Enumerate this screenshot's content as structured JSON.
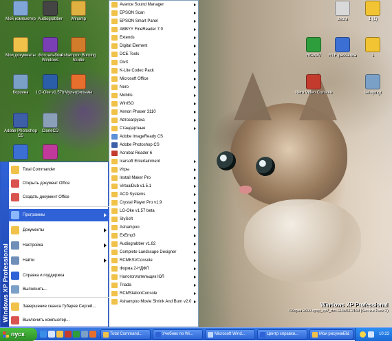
{
  "colors": {
    "taskbar": "#1f57c9",
    "start_green": "#2d8f27",
    "menu_highlight": "#2f62d7",
    "menu_border": "#7f9db9"
  },
  "desktop_icons": [
    {
      "label": "Мой компьютер",
      "icon": "my-computer-icon",
      "color": "#7fa6d6"
    },
    {
      "label": "Audiograbber",
      "icon": "audiograbber-icon",
      "color": "#444"
    },
    {
      "label": "Winamp",
      "icon": "winamp-icon",
      "color": "#e0b040"
    },
    {
      "label": "Мои документы",
      "icon": "folder-icon",
      "color": "#f1c24a"
    },
    {
      "label": "Фотоальбом Windows",
      "icon": "photo-album-icon",
      "color": "#7a3fb5"
    },
    {
      "label": "Ashampoo Burning Studio",
      "icon": "ashampoo-icon",
      "color": "#d07c2a"
    },
    {
      "label": "Корзина",
      "icon": "recycle-bin-icon",
      "color": "#7aa0c7"
    },
    {
      "label": "LG-Oke v1.57b",
      "icon": "lg-oke-icon",
      "color": "#2b5ea8"
    },
    {
      "label": "Мультфильмы",
      "icon": "cartoons-icon",
      "color": "#e76f2e"
    },
    {
      "label": "Adobe Photoshop CS",
      "icon": "photoshop-icon",
      "color": "#3d5fa8"
    },
    {
      "label": "CloneCD",
      "icon": "clonecd-icon",
      "color": "#8aa0b8"
    },
    {
      "label": "",
      "icon": "app-icon",
      "color": "#3b6fd4"
    },
    {
      "label": "",
      "icon": "app2-icon",
      "color": "#c2399c"
    },
    {
      "label": "zebra",
      "icon": "zebra-icon",
      "color": "#d9d9d9"
    },
    {
      "label": "1 (1)",
      "icon": "doc-icon",
      "color": "#f2c332"
    },
    {
      "label": "RCM3V",
      "icon": "rcm-icon",
      "color": "#2e9d3b"
    },
    {
      "label": "RTF-рассылка",
      "icon": "rtf-icon",
      "color": "#3b6fd4"
    },
    {
      "label": "1",
      "icon": "doc2-icon",
      "color": "#f2c332"
    },
    {
      "label": "Nero Video Console",
      "icon": "nero-icon",
      "color": "#c23b2d"
    },
    {
      "label": "setupmgr",
      "icon": "setup-icon",
      "color": "#7aa0c7"
    }
  ],
  "start_menu": {
    "strip_text": "Windows XP Professional",
    "pinned": [
      {
        "label": "Total Commander",
        "icon": "total-commander-icon"
      },
      {
        "label": "Открыть документ Office",
        "icon": "office-open-icon"
      },
      {
        "label": "Создать документ Office",
        "icon": "office-new-icon"
      }
    ],
    "items": [
      {
        "label": "Программы",
        "icon": "programs-icon",
        "arrow": true,
        "highlight": true
      },
      {
        "label": "Документы",
        "icon": "documents-icon",
        "arrow": true
      },
      {
        "label": "Настройка",
        "icon": "settings-icon",
        "arrow": true
      },
      {
        "label": "Найти",
        "icon": "search-icon",
        "arrow": true
      },
      {
        "label": "Справка и поддержка",
        "icon": "help-icon",
        "arrow": false
      },
      {
        "label": "Выполнить...",
        "icon": "run-icon",
        "arrow": false
      },
      {
        "label": "Завершение сеанса Губарев Сергей...",
        "icon": "logoff-icon",
        "arrow": false
      },
      {
        "label": "Выключить компьютер...",
        "icon": "shutdown-icon",
        "arrow": false
      }
    ]
  },
  "programs_menu": {
    "items": [
      {
        "label": "Avance Sound Manager",
        "arrow": true
      },
      {
        "label": "EPSON Scan",
        "arrow": true
      },
      {
        "label": "EPSON Smart Panel",
        "arrow": true
      },
      {
        "label": "ABBYY FineReader 7.0",
        "arrow": true
      },
      {
        "label": "Extends",
        "arrow": true
      },
      {
        "label": "Digital Element",
        "arrow": true
      },
      {
        "label": "DCE Tools",
        "arrow": true
      },
      {
        "label": "DivX",
        "arrow": true
      },
      {
        "label": "K-Lite Codec Pack",
        "arrow": true
      },
      {
        "label": "Microsoft Office",
        "arrow": true
      },
      {
        "label": "Nero",
        "arrow": true
      },
      {
        "label": "Mobilis",
        "arrow": true
      },
      {
        "label": "WinISO",
        "arrow": true
      },
      {
        "label": "Xenon Phaser 3110",
        "arrow": true
      },
      {
        "label": "Автозагрузка",
        "arrow": true
      },
      {
        "label": "Стандартные",
        "arrow": true
      },
      {
        "label": "Adobe ImageReady CS",
        "arrow": false
      },
      {
        "label": "Adobe Photoshop CS",
        "arrow": false
      },
      {
        "label": "Acrobat Reader 6",
        "arrow": false
      },
      {
        "label": "Icarsoft Entertainment",
        "arrow": true
      },
      {
        "label": "Игры",
        "arrow": true
      },
      {
        "label": "Install Maker Pro",
        "arrow": true
      },
      {
        "label": "VirtualDub v1.5.1",
        "arrow": true
      },
      {
        "label": "ACD Systems",
        "arrow": true
      },
      {
        "label": "Crystal Player Pro v1.9",
        "arrow": true
      },
      {
        "label": "LG-Oke v1.57 beta",
        "arrow": true
      },
      {
        "label": "SlySoft",
        "arrow": true
      },
      {
        "label": "Ashampoo",
        "arrow": true
      },
      {
        "label": "ExEmp3",
        "arrow": true
      },
      {
        "label": "Audiograbber v1.82",
        "arrow": true
      },
      {
        "label": "Complete Landscape Designer",
        "arrow": true
      },
      {
        "label": "RCMKSVConsole",
        "arrow": true
      },
      {
        "label": "Форма 2-НДФЛ",
        "arrow": true
      },
      {
        "label": "Налогоплательщик ЮЛ",
        "arrow": true
      },
      {
        "label": "Triada",
        "arrow": true
      },
      {
        "label": "RCMStationConsole",
        "arrow": true
      },
      {
        "label": "Ashampoo Movie Shrink And Burn v2.0",
        "arrow": true
      }
    ]
  },
  "taskbar": {
    "start_label": "пуск",
    "buttons": [
      {
        "label": "Total Command...",
        "icon": "total-commander-icon"
      },
      {
        "label": "Учебник по Wi...",
        "icon": "word-icon"
      },
      {
        "label": "Microsoft Wind...",
        "icon": "windows-icon"
      },
      {
        "label": "Центр справки...",
        "icon": "help-center-icon"
      },
      {
        "label": "Мои рисунки -...",
        "icon": "pictures-icon"
      }
    ],
    "lang": "EN",
    "clock": "10:23"
  },
  "watermark": {
    "line1": "Windows XP Professional",
    "line2": "Сборка 2600.xpsp_sp2_rtm.040803-2158 (Service Pack 2)"
  }
}
